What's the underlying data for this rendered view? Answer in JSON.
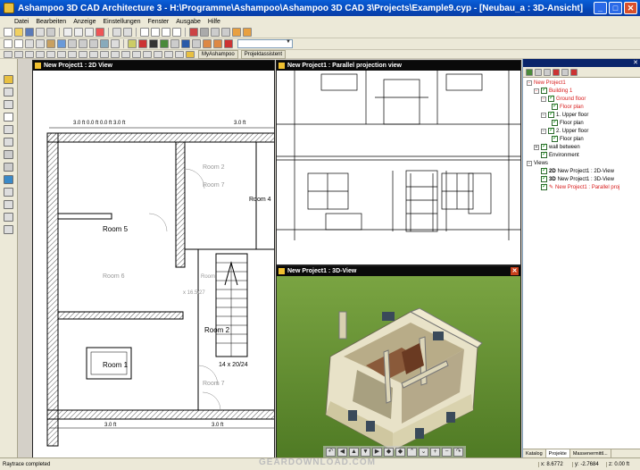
{
  "window": {
    "title": "Ashampoo 3D CAD Architecture 3 - H:\\Programme\\Ashampoo\\Ashampoo 3D CAD 3\\Projects\\Example9.cyp - [Neubau_a : 3D-Ansicht]"
  },
  "menu": [
    "Datei",
    "Bearbeiten",
    "Anzeige",
    "Einstellungen",
    "Fenster",
    "Ausgabe",
    "Hilfe"
  ],
  "toolbar3": {
    "tab1": "MyAshampoo",
    "tab2": "Projektassistent"
  },
  "panels": {
    "plan": {
      "title": "New Project1 : 2D View"
    },
    "parallel": {
      "title": "New Project1 : Parallel projection view"
    },
    "view3d": {
      "title": "New Project1 : 3D-View"
    }
  },
  "plan": {
    "dim_top": "3.0 ft    0.0 ft    0.0 ft    3.0 ft",
    "dim_top_right": "3.0 ft",
    "room5": "Room 5",
    "room6": "Room 6",
    "room7a": "Room 7",
    "room2a": "Room 2",
    "room4": "Room 4",
    "room2b": "Room 2",
    "room1": "Room 1",
    "room7b": "Room 7",
    "roomx": "Room",
    "stair_dim": "14 x 20/24",
    "stair_dim2": "x 16.5/27",
    "dim_bottom1": "3.0 ft",
    "dim_bottom2": "3.0 ft"
  },
  "tree": {
    "root": "New Project1",
    "building": "Building 1",
    "ground": "Ground floor",
    "floorplan1": "Floor plan",
    "upper1": "1. Upper floor",
    "floorplan2": "Floor plan",
    "upper2": "2. Upper floor",
    "floorplan3": "Floor plan",
    "wall": "wall between",
    "env": "Environment",
    "views": "Views",
    "v1": "New Project1 : 2D-View",
    "v2": "New Project1 : 3D-View",
    "v3": "New Project1 : Parallel proj",
    "v1_tag": "2D",
    "v2_tag": "3D"
  },
  "right_tabs": [
    "Katalog",
    "Projekte",
    "Massenermittl..."
  ],
  "status": {
    "left": "Raytrace completed",
    "x": "x: 8.6772",
    "y": "y: -2.7684",
    "z": "z: 0.00 ft"
  },
  "watermark": "GEARDOWNLOAD.COM"
}
